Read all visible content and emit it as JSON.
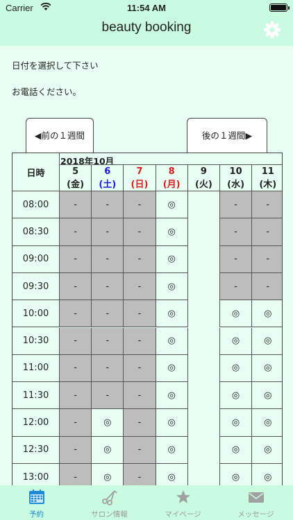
{
  "status": {
    "carrier": "Carrier",
    "time": "11:54 AM"
  },
  "app": {
    "title": "beauty booking"
  },
  "prompts": [
    "日付を選択して下さい",
    "お電話ください。"
  ],
  "week_nav": {
    "prev": "前の１週間",
    "next": "後の１週間"
  },
  "table": {
    "header_label": "日時",
    "month": "2018年10月",
    "days": [
      {
        "date": "5",
        "weekday": "(金)",
        "color": "#222222"
      },
      {
        "date": "6",
        "weekday": "(土)",
        "color": "#1a1adc"
      },
      {
        "date": "7",
        "weekday": "(日)",
        "color": "#d41c1c"
      },
      {
        "date": "8",
        "weekday": "(月)",
        "color": "#d41c1c"
      },
      {
        "date": "9",
        "weekday": "(火)",
        "color": "#222222"
      },
      {
        "date": "10",
        "weekday": "(水)",
        "color": "#222222"
      },
      {
        "date": "11",
        "weekday": "(木)",
        "color": "#222222"
      }
    ],
    "rows": [
      {
        "time": "08:00",
        "cells": [
          "-",
          "-",
          "-",
          "◎",
          "",
          "-",
          "-"
        ]
      },
      {
        "time": "08:30",
        "cells": [
          "-",
          "-",
          "-",
          "◎",
          "",
          "-",
          "-"
        ]
      },
      {
        "time": "09:00",
        "cells": [
          "-",
          "-",
          "-",
          "◎",
          "",
          "-",
          "-"
        ]
      },
      {
        "time": "09:30",
        "cells": [
          "-",
          "-",
          "-",
          "◎",
          "",
          "-",
          "-"
        ]
      },
      {
        "time": "10:00",
        "cells": [
          "-",
          "-",
          "-",
          "◎",
          "",
          "◎",
          "◎"
        ]
      },
      {
        "time": "10:30",
        "cells": [
          "-",
          "-",
          "-",
          "◎",
          "",
          "◎",
          "◎"
        ]
      },
      {
        "time": "11:00",
        "cells": [
          "-",
          "-",
          "-",
          "◎",
          "",
          "◎",
          "◎"
        ]
      },
      {
        "time": "11:30",
        "cells": [
          "-",
          "-",
          "-",
          "◎",
          "",
          "◎",
          "◎"
        ]
      },
      {
        "time": "12:00",
        "cells": [
          "-",
          "◎",
          "-",
          "◎",
          "",
          "◎",
          "◎"
        ]
      },
      {
        "time": "12:30",
        "cells": [
          "-",
          "◎",
          "-",
          "◎",
          "",
          "◎",
          "◎"
        ]
      },
      {
        "time": "13:00",
        "cells": [
          "-",
          "◎",
          "-",
          "◎",
          "",
          "◎",
          "◎"
        ]
      }
    ]
  },
  "tabs": [
    {
      "label": "予約",
      "icon": "calendar-icon",
      "active": true
    },
    {
      "label": "サロン情報",
      "icon": "scissors-icon",
      "active": false
    },
    {
      "label": "マイページ",
      "icon": "star-icon",
      "active": false
    },
    {
      "label": "メッセージ",
      "icon": "envelope-icon",
      "active": false
    }
  ],
  "colors": {
    "tint": "#c9fbe0",
    "content_bg": "#e9fef3",
    "closed_cell": "#bdbdbd",
    "active_tab": "#1f8bd8",
    "inactive_tab": "#9a9a9a"
  }
}
